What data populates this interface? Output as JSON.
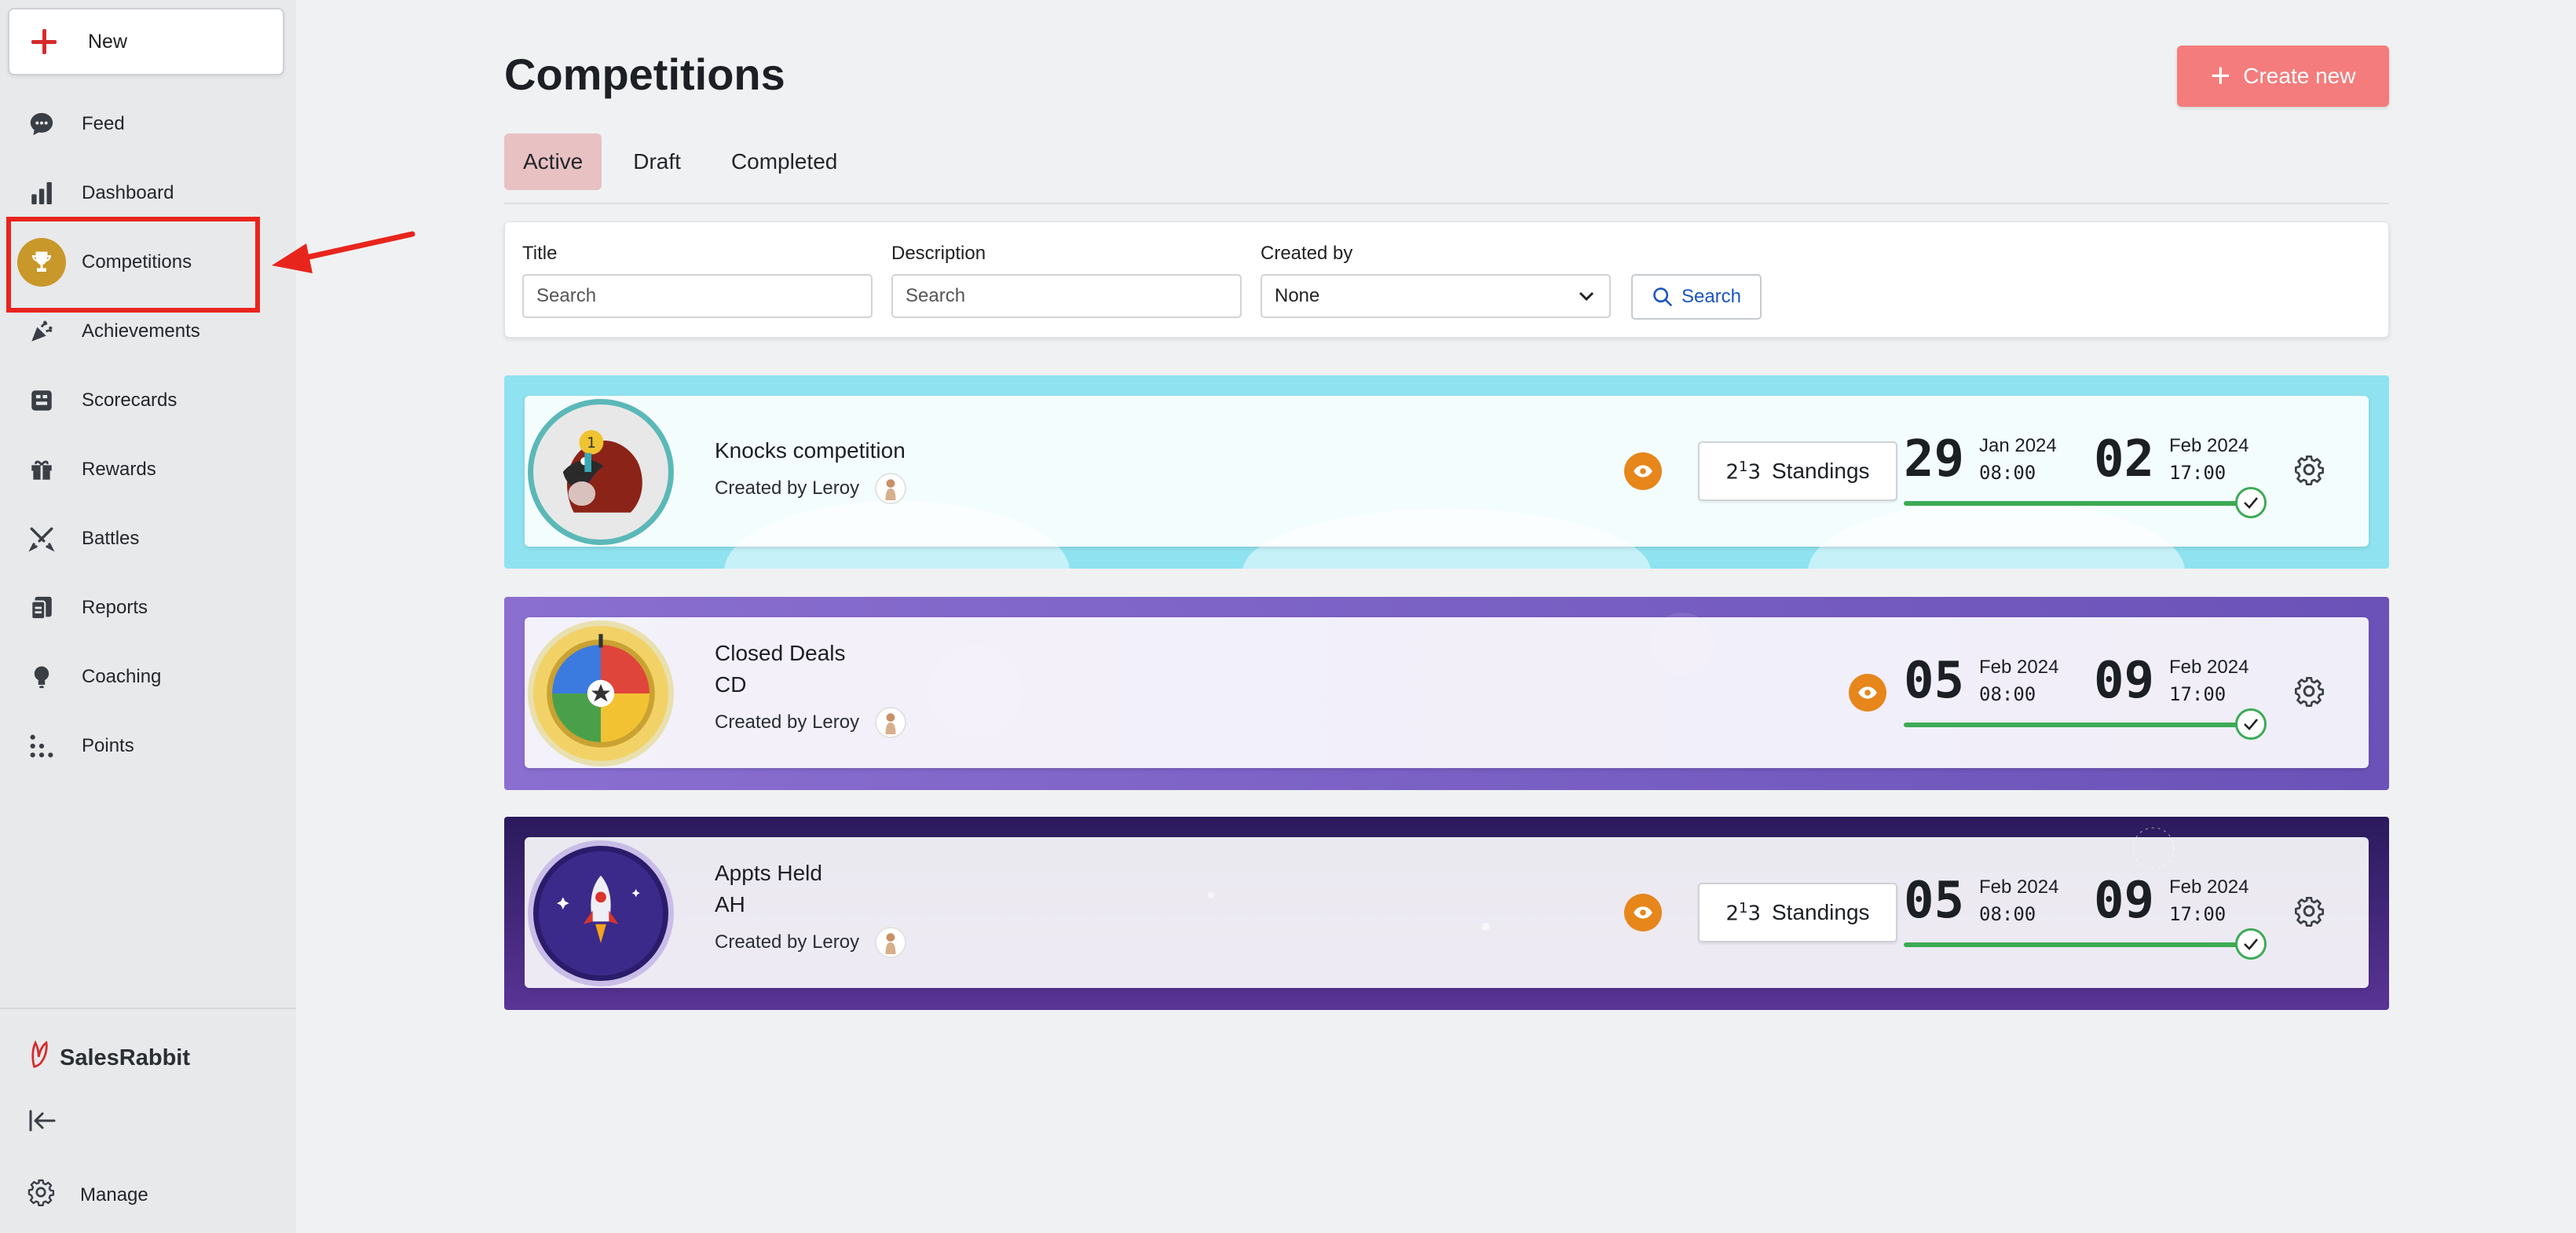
{
  "sidebar": {
    "new_label": "New",
    "items": [
      {
        "label": "Feed",
        "icon": "chat-icon"
      },
      {
        "label": "Dashboard",
        "icon": "bar-chart-icon"
      },
      {
        "label": "Competitions",
        "icon": "trophy-icon",
        "active": true
      },
      {
        "label": "Achievements",
        "icon": "party-popper-icon"
      },
      {
        "label": "Scorecards",
        "icon": "scorecard-icon"
      },
      {
        "label": "Rewards",
        "icon": "gift-icon"
      },
      {
        "label": "Battles",
        "icon": "swords-icon"
      },
      {
        "label": "Reports",
        "icon": "reports-icon"
      },
      {
        "label": "Coaching",
        "icon": "lightbulb-icon"
      },
      {
        "label": "Points",
        "icon": "dots-grid-icon"
      }
    ],
    "brand": "SalesRabbit",
    "manage_label": "Manage"
  },
  "header": {
    "title": "Competitions",
    "create_label": "Create new"
  },
  "tabs": [
    {
      "label": "Active",
      "active": true
    },
    {
      "label": "Draft"
    },
    {
      "label": "Completed"
    }
  ],
  "filters": {
    "title_label": "Title",
    "title_placeholder": "Search",
    "description_label": "Description",
    "description_placeholder": "Search",
    "created_by_label": "Created by",
    "created_by_value": "None",
    "search_label": "Search"
  },
  "competitions": [
    {
      "title": "Knocks competition",
      "subtitle": "",
      "created_by": "Created by Leroy",
      "standings_label": "Standings",
      "start_day": "29",
      "start_month": "Jan 2024",
      "start_time": "08:00",
      "end_day": "02",
      "end_month": "Feb 2024",
      "end_time": "17:00",
      "progress": 1.0,
      "bg": "#9ee6f1"
    },
    {
      "title": "Closed Deals",
      "subtitle": "CD",
      "created_by": "Created by Leroy",
      "standings_label": "",
      "start_day": "05",
      "start_month": "Feb 2024",
      "start_time": "08:00",
      "end_day": "09",
      "end_month": "Feb 2024",
      "end_time": "17:00",
      "progress": 1.0,
      "bg": "#7a62c2"
    },
    {
      "title": "Appts Held",
      "subtitle": "AH",
      "created_by": "Created by Leroy",
      "standings_label": "Standings",
      "start_day": "05",
      "start_month": "Feb 2024",
      "start_time": "08:00",
      "end_day": "09",
      "end_month": "Feb 2024",
      "end_time": "17:00",
      "progress": 1.0,
      "bg": "#3a2470"
    }
  ]
}
